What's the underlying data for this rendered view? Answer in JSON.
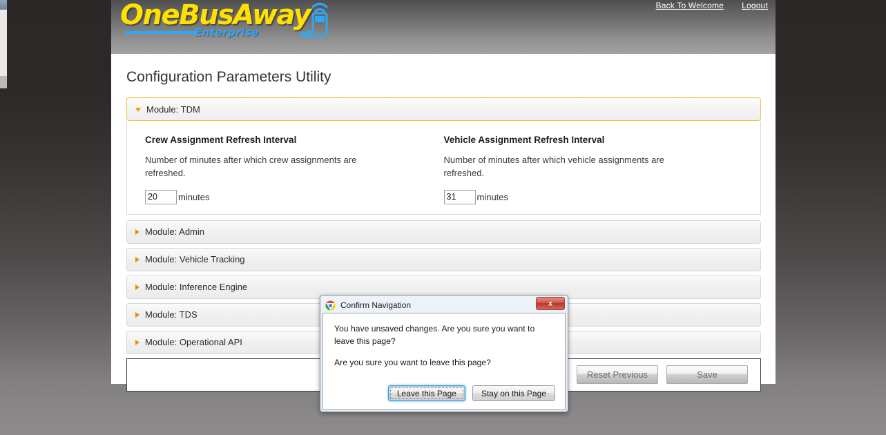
{
  "header": {
    "logo_text": "OneBusAway",
    "logo_subtitle": "Enterprise",
    "links": [
      {
        "label": "Back To Welcome",
        "name": "back-to-welcome-link"
      },
      {
        "label": "Logout",
        "name": "logout-link"
      }
    ]
  },
  "page": {
    "title": "Configuration Parameters Utility"
  },
  "modules": [
    {
      "label": "Module: TDM",
      "expanded": true
    },
    {
      "label": "Module: Admin",
      "expanded": false
    },
    {
      "label": "Module: Vehicle Tracking",
      "expanded": false
    },
    {
      "label": "Module: Inference Engine",
      "expanded": false
    },
    {
      "label": "Module: TDS",
      "expanded": false
    },
    {
      "label": "Module: Operational API",
      "expanded": false
    }
  ],
  "parameters": [
    {
      "title": "Crew Assignment Refresh Interval",
      "description": "Number of minutes after which crew assignments are refreshed.",
      "value": "20",
      "unit": "minutes"
    },
    {
      "title": "Vehicle Assignment Refresh Interval",
      "description": "Number of minutes after which vehicle assignments are refreshed.",
      "value": "31",
      "unit": "minutes"
    }
  ],
  "actions": {
    "reset_label": "Reset Previous",
    "save_label": "Save"
  },
  "dialog": {
    "title": "Confirm Navigation",
    "icon": "chrome-icon",
    "close_label": "x",
    "message_1": "You have unsaved changes. Are you sure you want to leave this page?",
    "message_2": "Are you sure you want to leave this page?",
    "primary_button": "Leave this Page",
    "secondary_button": "Stay on this Page"
  },
  "colors": {
    "accent_orange": "#f0a000",
    "logo_yellow": "#ffe000",
    "logo_blue": "#2ea8f5",
    "close_red": "#bc3428"
  }
}
